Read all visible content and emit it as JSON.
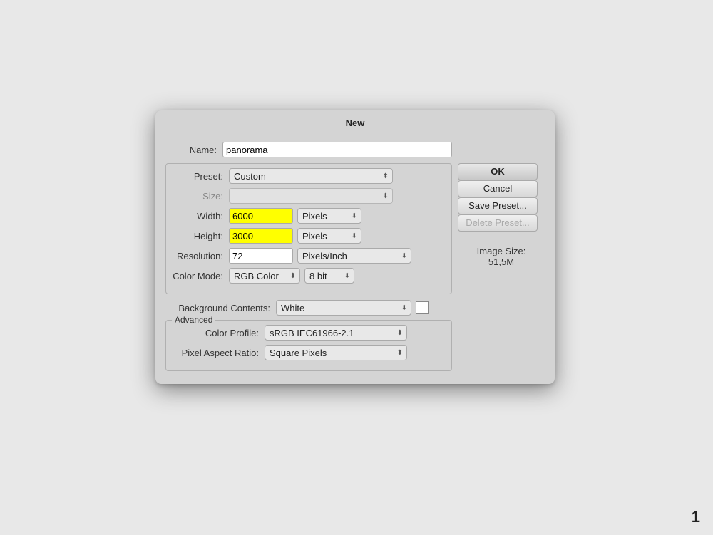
{
  "dialog": {
    "title": "New",
    "name_label": "Name:",
    "name_value": "panorama",
    "preset_legend": "Preset",
    "preset_label": "Preset:",
    "preset_value": "Custom",
    "size_label": "Size:",
    "size_value": "",
    "width_label": "Width:",
    "width_value": "6000",
    "width_unit": "Pixels",
    "height_label": "Height:",
    "height_value": "3000",
    "height_unit": "Pixels",
    "resolution_label": "Resolution:",
    "resolution_value": "72",
    "resolution_unit": "Pixels/Inch",
    "color_mode_label": "Color Mode:",
    "color_mode_value": "RGB Color",
    "bit_depth_value": "8 bit",
    "bg_contents_label": "Background Contents:",
    "bg_contents_value": "White",
    "advanced_legend": "Advanced",
    "color_profile_label": "Color Profile:",
    "color_profile_value": "sRGB IEC61966-2.1",
    "pixel_aspect_label": "Pixel Aspect Ratio:",
    "pixel_aspect_value": "Square Pixels",
    "image_size_label": "Image Size:",
    "image_size_value": "51,5M",
    "btn_ok": "OK",
    "btn_cancel": "Cancel",
    "btn_save_preset": "Save Preset...",
    "btn_delete_preset": "Delete Preset..."
  },
  "page_number": "1"
}
